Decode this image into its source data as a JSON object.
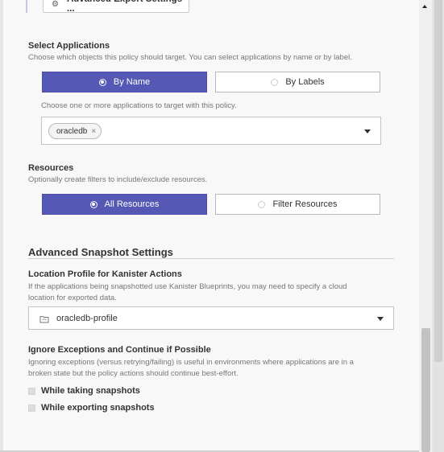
{
  "header": {
    "export_settings_label": "Advanced Export Settings ..."
  },
  "select_applications": {
    "title": "Select Applications",
    "description": "Choose which objects this policy should target. You can select applications by name or by label.",
    "options": [
      {
        "label": "By Name",
        "selected": true
      },
      {
        "label": "By Labels",
        "selected": false
      }
    ],
    "hint": "Choose one or more applications to target with this policy.",
    "selected_chip": "oracledb",
    "chip_remove": "×"
  },
  "resources": {
    "title": "Resources",
    "description": "Optionally create filters to include/exclude resources.",
    "options": [
      {
        "label": "All Resources",
        "selected": true
      },
      {
        "label": "Filter Resources",
        "selected": false
      }
    ]
  },
  "advanced_snapshot": {
    "title": "Advanced Snapshot Settings",
    "location_title": "Location Profile for Kanister Actions",
    "location_description_line1": "If the applications being snapshotted use Kanister Blueprints, you may need to specify a cloud",
    "location_description_line2": "location for exported data.",
    "location_value": "oracledb-profile",
    "ignore_title": "Ignore Exceptions and Continue if Possible",
    "ignore_description_line1": "Ignoring exceptions (versus retrying/failing) is useful in environments where applications are in a",
    "ignore_description_line2": "broken state but the policy actions should continue best-effort.",
    "checkboxes": [
      {
        "label": "While taking snapshots",
        "checked": false
      },
      {
        "label": "While exporting snapshots",
        "checked": false
      }
    ]
  },
  "colors": {
    "accent": "#5558b5"
  }
}
